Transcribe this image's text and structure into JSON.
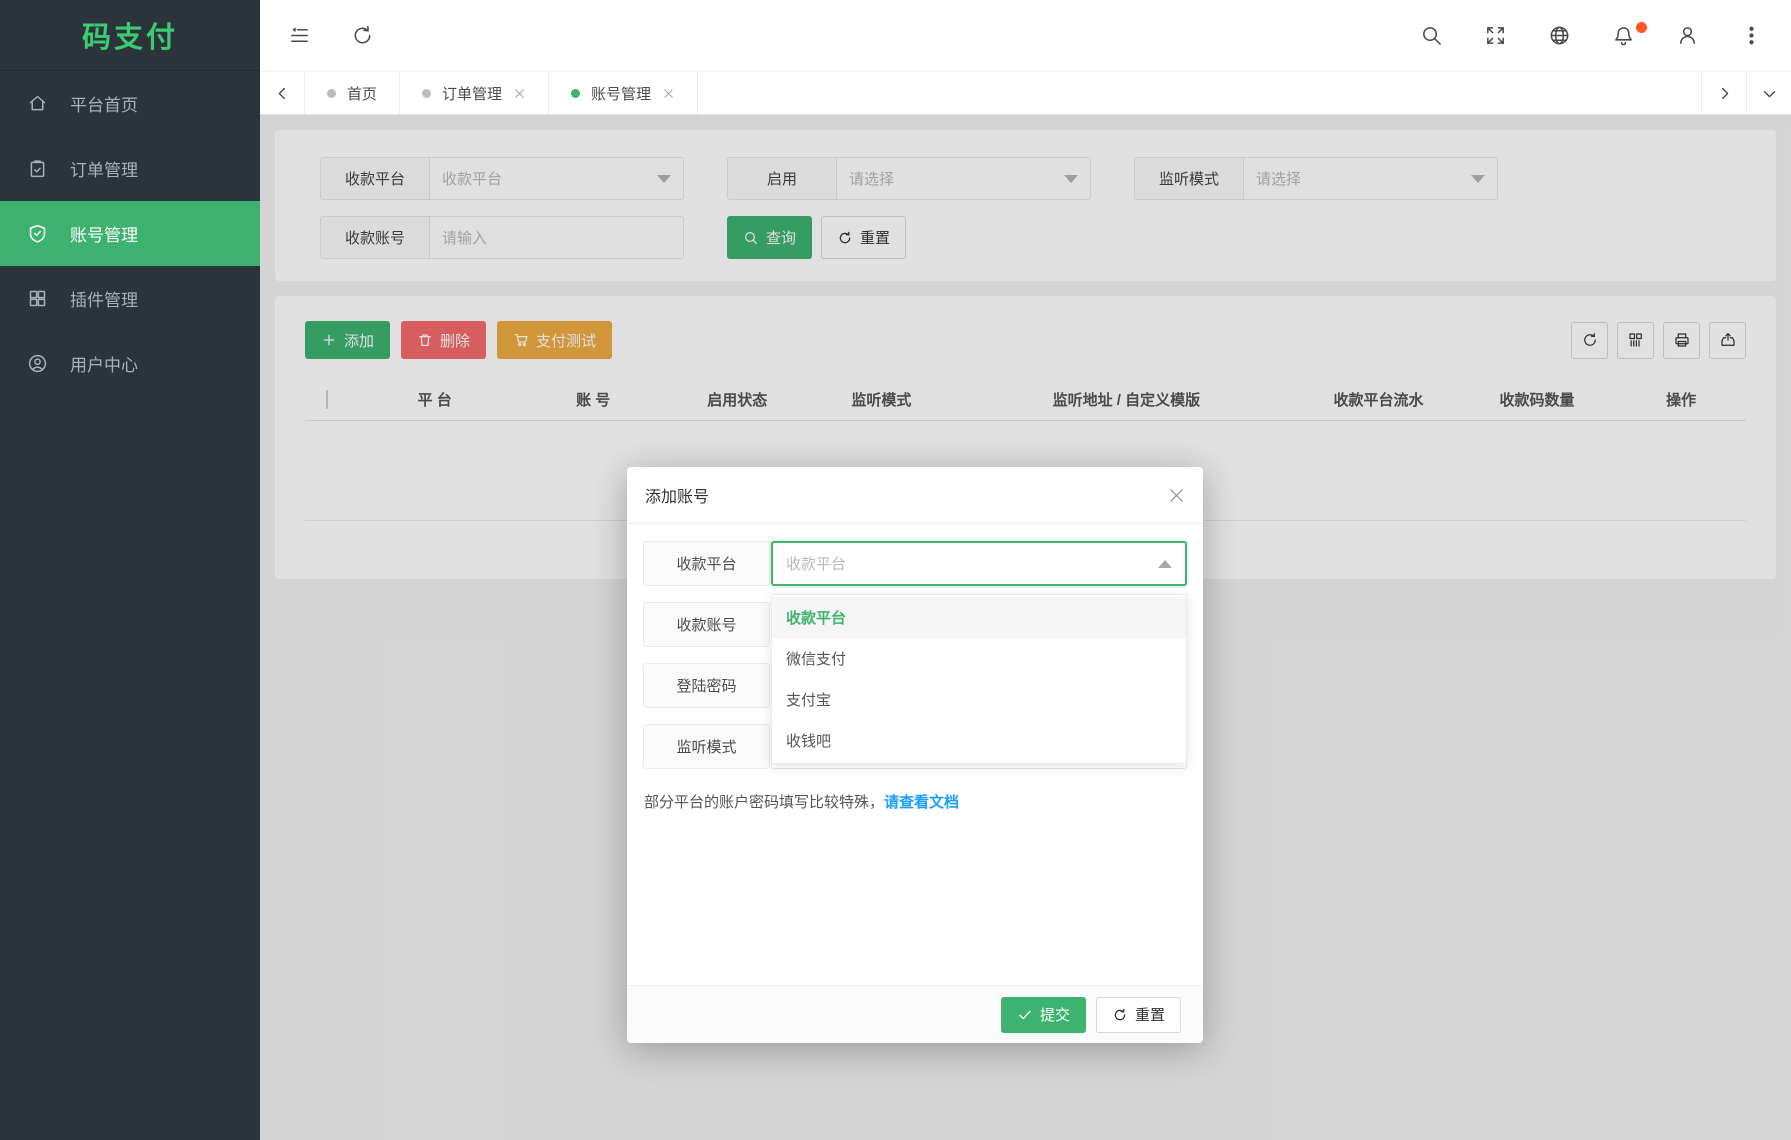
{
  "app": {
    "logo": "码支付"
  },
  "sidebar": {
    "items": [
      {
        "label": "平台首页",
        "icon": "home-icon",
        "active": false
      },
      {
        "label": "订单管理",
        "icon": "clipboard-check-icon",
        "active": false
      },
      {
        "label": "账号管理",
        "icon": "shield-check-icon",
        "active": true
      },
      {
        "label": "插件管理",
        "icon": "grid-icon",
        "active": false
      },
      {
        "label": "用户中心",
        "icon": "user-circle-icon",
        "active": false
      }
    ]
  },
  "topbar": {
    "left_icons": [
      "collapse-menu-icon",
      "refresh-icon"
    ],
    "right_icons": [
      "search-icon",
      "fullscreen-icon",
      "globe-icon",
      "bell-icon",
      "user-icon",
      "more-vertical-icon"
    ],
    "notification_badge": true
  },
  "tabs": {
    "items": [
      {
        "label": "首页",
        "active": false,
        "closable": false
      },
      {
        "label": "订单管理",
        "active": false,
        "closable": true
      },
      {
        "label": "账号管理",
        "active": true,
        "closable": true
      }
    ]
  },
  "filters": {
    "platform": {
      "label": "收款平台",
      "placeholder": "收款平台"
    },
    "enabled": {
      "label": "启用",
      "placeholder": "请选择"
    },
    "listen_mode": {
      "label": "监听模式",
      "placeholder": "请选择"
    },
    "account": {
      "label": "收款账号",
      "placeholder": "请输入"
    },
    "search_button": "查询",
    "reset_button": "重置"
  },
  "toolbar": {
    "add_button": "添加",
    "delete_button": "删除",
    "pay_test_button": "支付测试",
    "right_icons": [
      "refresh-icon",
      "columns-icon",
      "printer-icon",
      "export-icon"
    ]
  },
  "table": {
    "headers": [
      "平 台",
      "账 号",
      "启用状态",
      "监听模式",
      "监听地址 / 自定义模版",
      "收款平台流水",
      "收款码数量",
      "操作"
    ]
  },
  "modal": {
    "title": "添加账号",
    "fields": [
      {
        "label": "收款平台",
        "placeholder": "收款平台",
        "focused": true
      },
      {
        "label": "收款账号"
      },
      {
        "label": "登陆密码"
      },
      {
        "label": "监听模式"
      }
    ],
    "dropdown_options": [
      {
        "label": "收款平台",
        "selected": true
      },
      {
        "label": "微信支付",
        "selected": false
      },
      {
        "label": "支付宝",
        "selected": false
      },
      {
        "label": "收钱吧",
        "selected": false
      }
    ],
    "note_text": "部分平台的账户密码填写比较特殊，",
    "note_link": "请查看文档",
    "submit_button": "提交",
    "reset_button": "重置"
  },
  "colors": {
    "accent_green": "#3eb370",
    "logo_green": "#3ccb71",
    "danger_red": "#f56c6c",
    "warning_orange": "#efab43",
    "link_blue": "#1e9fff",
    "badge_orange": "#ff5722",
    "sidebar_bg": "#2b333b"
  }
}
